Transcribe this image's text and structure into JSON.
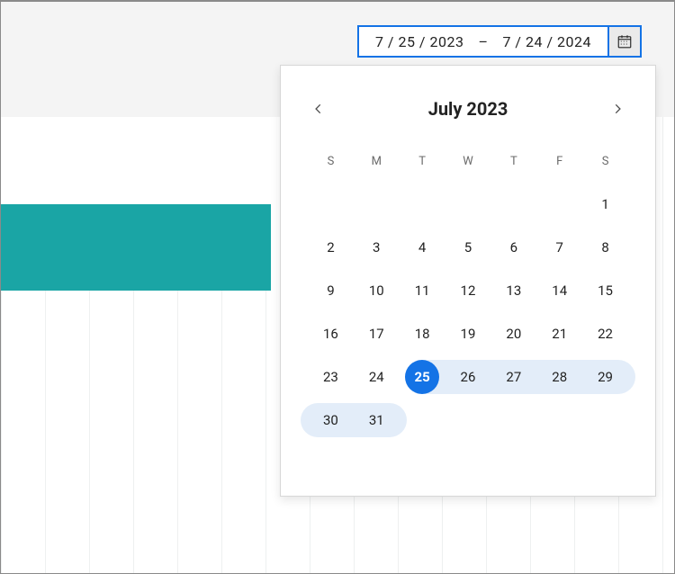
{
  "daterange": {
    "start": "7 / 25 / 2023",
    "dash": "–",
    "end": "7 / 24 / 2024"
  },
  "calendar": {
    "month_title": "July 2023",
    "dow": [
      "S",
      "M",
      "T",
      "W",
      "T",
      "F",
      "S"
    ],
    "days": {
      "r0": [
        "",
        "",
        "",
        "",
        "",
        "",
        "1"
      ],
      "r1": [
        "2",
        "3",
        "4",
        "5",
        "6",
        "7",
        "8"
      ],
      "r2": [
        "9",
        "10",
        "11",
        "12",
        "13",
        "14",
        "15"
      ],
      "r3": [
        "16",
        "17",
        "18",
        "19",
        "20",
        "21",
        "22"
      ],
      "r4": [
        "23",
        "24",
        "25",
        "26",
        "27",
        "28",
        "29"
      ],
      "r5": [
        "30",
        "31",
        "",
        "",
        "",
        "",
        ""
      ]
    }
  },
  "colors": {
    "accent": "#1473e6",
    "range_bg": "#e3edf9",
    "teal": "#1aa5a5"
  }
}
